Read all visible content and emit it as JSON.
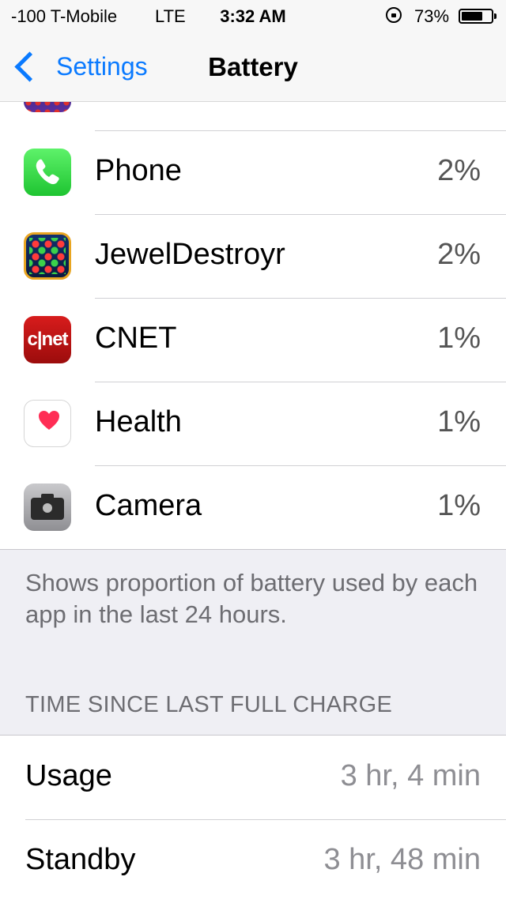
{
  "status_bar": {
    "carrier": "-100 T-Mobile",
    "network": "LTE",
    "time": "3:32 AM",
    "battery_percent": "73%",
    "battery_level": 0.73
  },
  "nav": {
    "back_label": "Settings",
    "title": "Battery"
  },
  "apps": [
    {
      "name": "Phone",
      "percent": "2%",
      "icon": "phone-icon"
    },
    {
      "name": "JewelDestroyr",
      "percent": "2%",
      "icon": "jewel-icon"
    },
    {
      "name": "CNET",
      "percent": "1%",
      "icon": "cnet-icon",
      "icon_text": "c|net"
    },
    {
      "name": "Health",
      "percent": "1%",
      "icon": "heart-icon"
    },
    {
      "name": "Camera",
      "percent": "1%",
      "icon": "camera-icon"
    }
  ],
  "footer_note": "Shows proportion of battery used by each app in the last 24 hours.",
  "time_section": {
    "header": "TIME SINCE LAST FULL CHARGE",
    "usage_label": "Usage",
    "usage_value": "3 hr, 4 min",
    "standby_label": "Standby",
    "standby_value": "3 hr, 48 min"
  },
  "colors": {
    "accent": "#0a7aff",
    "background": "#efeff4"
  }
}
